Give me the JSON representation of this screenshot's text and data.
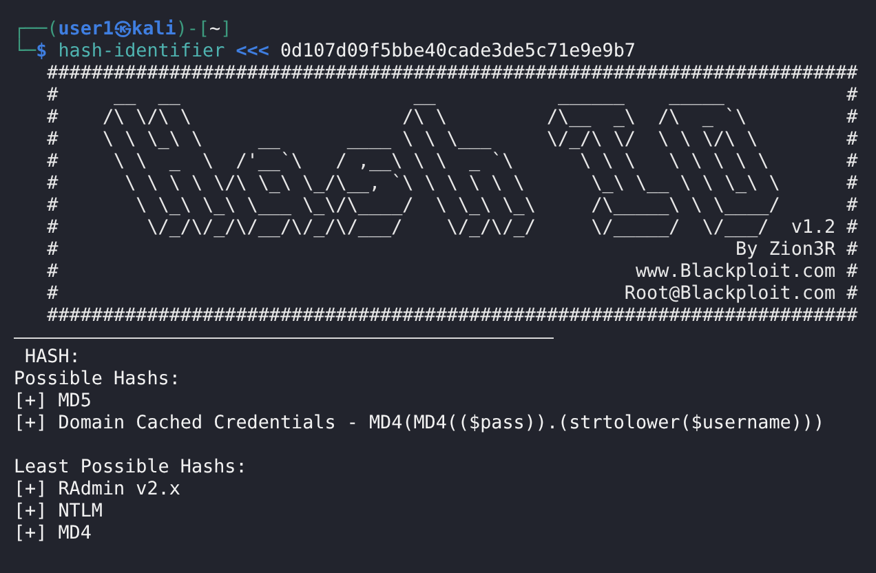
{
  "prompt": {
    "frame_top": "┌──(",
    "user": "user1",
    "at": "㉿",
    "host": "kali",
    "dir_open": ")-[",
    "dir": "~",
    "dir_close": "]",
    "frame_bottom": "└─",
    "symbol": "$",
    "command": "hash-identifier",
    "operator": "<<<",
    "argument": "0d107d09f5bbe40cade3de5c71e9e9b7"
  },
  "banner": [
    "   #########################################################################",
    "   #     __  __                     __           ______    _____           #",
    "   #    /\\ \\/\\ \\                   /\\ \\         /\\__  _\\  /\\  _ `\\         #",
    "   #    \\ \\ \\_\\ \\     __      ____ \\ \\ \\___     \\/_/\\ \\/  \\ \\ \\/\\ \\        #",
    "   #     \\ \\  _  \\  /'__`\\   / ,__\\ \\ \\  _ `\\      \\ \\ \\   \\ \\ \\ \\ \\       #",
    "   #      \\ \\ \\ \\ \\/\\ \\_\\ \\_/\\__, `\\ \\ \\ \\ \\ \\      \\_\\ \\__ \\ \\ \\_\\ \\      #",
    "   #       \\ \\_\\ \\_\\ \\___ \\_\\/\\____/  \\ \\_\\ \\_\\     /\\_____\\ \\ \\____/      #",
    "   #        \\/_/\\/_/\\/__/\\/_/\\/___/    \\/_/\\/_/     \\/_____/  \\/___/  v1.2 #",
    "   #                                                             By Zion3R #",
    "   #                                                    www.Blackploit.com #",
    "   #                                                   Root@Blackploit.com #",
    "   #########################################################################"
  ],
  "output": [
    {
      "kind": "text",
      "text": " HASH:"
    },
    {
      "kind": "text",
      "text": "Possible Hashs:"
    },
    {
      "kind": "text",
      "text": "[+] MD5"
    },
    {
      "kind": "text",
      "text": "[+] Domain Cached Credentials - MD4(MD4(($pass)).(strtolower($username)))"
    },
    {
      "kind": "blank"
    },
    {
      "kind": "text",
      "text": "Least Possible Hashs:"
    },
    {
      "kind": "text",
      "text": "[+] RAdmin v2.x"
    },
    {
      "kind": "text",
      "text": "[+] NTLM"
    },
    {
      "kind": "text",
      "text": "[+] MD4"
    }
  ]
}
